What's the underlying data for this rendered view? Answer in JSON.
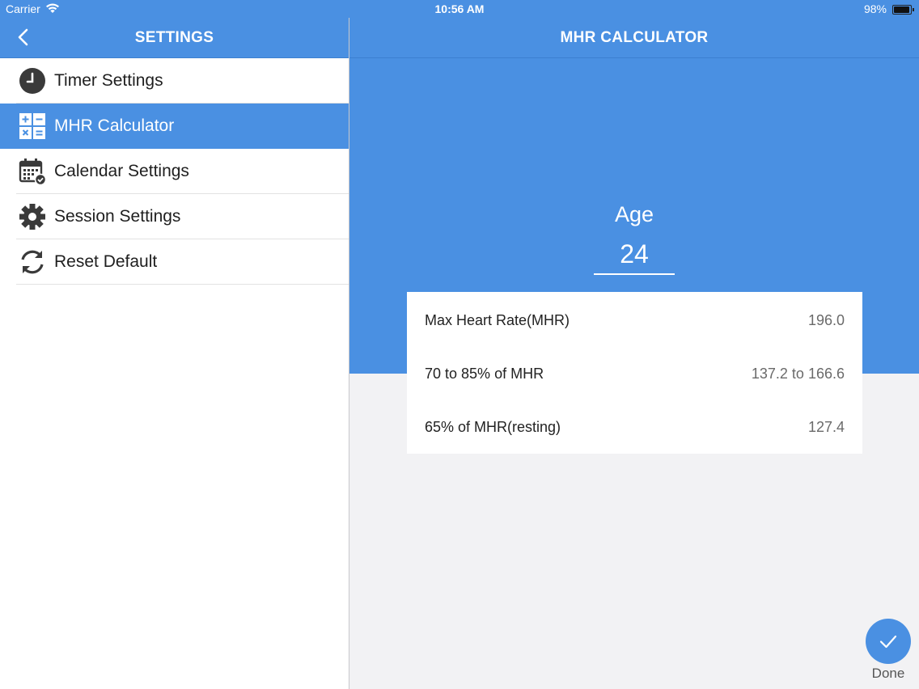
{
  "status_bar": {
    "carrier": "Carrier",
    "time": "10:56 AM",
    "battery": "98%",
    "icons": [
      "wifi-icon",
      "battery-icon"
    ]
  },
  "left": {
    "title": "SETTINGS",
    "back_icon": "chevron-left-icon",
    "menu": [
      {
        "label": "Timer Settings",
        "icon": "clock-icon",
        "active": false
      },
      {
        "label": "MHR Calculator",
        "icon": "calculator-icon",
        "active": true
      },
      {
        "label": "Calendar Settings",
        "icon": "calendar-icon",
        "active": false
      },
      {
        "label": "Session Settings",
        "icon": "gear-icon",
        "active": false
      },
      {
        "label": "Reset Default",
        "icon": "refresh-icon",
        "active": false
      }
    ]
  },
  "right": {
    "title": "MHR CALCULATOR",
    "age_label": "Age",
    "age_value": "24",
    "results": [
      {
        "label": "Max Heart Rate(MHR)",
        "value": "196.0"
      },
      {
        "label": "70 to 85% of MHR",
        "value": "137.2 to 166.6"
      },
      {
        "label": "65% of MHR(resting)",
        "value": "127.4"
      }
    ],
    "done_label": "Done",
    "done_icon": "checkmark-icon"
  },
  "colors": {
    "accent": "#4a90e2",
    "background": "#f2f2f4",
    "text": "#1f1f1f"
  }
}
